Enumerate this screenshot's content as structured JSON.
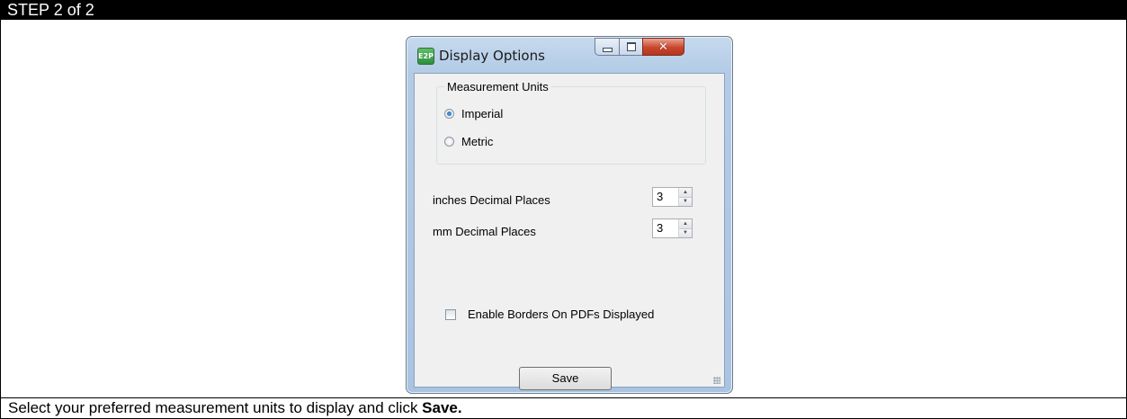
{
  "header": {
    "step_label": "STEP 2 of 2"
  },
  "dialog": {
    "title": "Display Options",
    "app_icon_text": "E2P",
    "measurement_group": {
      "legend": "Measurement Units",
      "options": [
        {
          "label": "Imperial",
          "selected": true
        },
        {
          "label": "Metric",
          "selected": false
        }
      ]
    },
    "inches_decimal": {
      "label": "inches Decimal Places",
      "value": "3"
    },
    "mm_decimal": {
      "label": "mm Decimal Places",
      "value": "3"
    },
    "enable_borders": {
      "label": "Enable Borders On PDFs Displayed",
      "checked": false
    },
    "save_label": "Save"
  },
  "footer": {
    "text_prefix": "Select your preferred measurement units to display and click ",
    "text_bold": "Save."
  },
  "colors": {
    "header_bg": "#000000",
    "header_fg": "#ffffff",
    "close_button": "#c9452c"
  }
}
